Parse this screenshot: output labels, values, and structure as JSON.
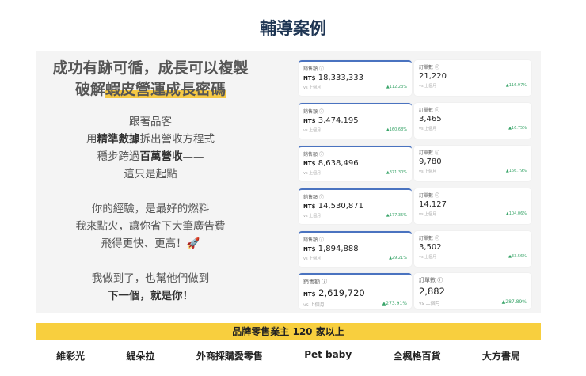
{
  "title": "輔導案例",
  "headline": {
    "line1": "成功有跡可循，成長可以複製",
    "line2_plain": "破解",
    "line2_highlight": "蝦皮營運成長密碼"
  },
  "para1": [
    [
      {
        "t": "跟著品客"
      }
    ],
    [
      {
        "t": "用"
      },
      {
        "t": "精準數據",
        "b": true
      },
      {
        "t": "拆出營收方程式"
      }
    ],
    [
      {
        "t": "穩步跨過"
      },
      {
        "t": "百萬營收",
        "b": true
      },
      {
        "t": "——"
      }
    ],
    [
      {
        "t": "這只是起點"
      }
    ]
  ],
  "para2": [
    "你的經驗，是最好的燃料",
    "我來點火，讓你省下大筆廣告費",
    "飛得更快、更高！🚀"
  ],
  "para3": {
    "line1": "我做到了，也幫他們做到",
    "line2": "下一個，就是你！"
  },
  "card_labels": {
    "sales": "銷售額",
    "orders": "訂單數",
    "currency": "NT$",
    "compare": "vs 上個月",
    "info_icon": "ⓘ",
    "up_icon": "▲"
  },
  "cases": [
    {
      "sales": "18,333,333",
      "sales_pct": "112.23%",
      "orders": "21,220",
      "orders_pct": "116.97%"
    },
    {
      "sales": "3,474,195",
      "sales_pct": "160.68%",
      "orders": "3,465",
      "orders_pct": "16.75%"
    },
    {
      "sales": "8,638,496",
      "sales_pct": "371.30%",
      "orders": "9,780",
      "orders_pct": "166.79%"
    },
    {
      "sales": "14,530,871",
      "sales_pct": "177.35%",
      "orders": "14,127",
      "orders_pct": "104.06%"
    },
    {
      "sales": "1,894,888",
      "sales_pct": "29.21%",
      "orders": "3,502",
      "orders_pct": "33.56%"
    },
    {
      "sales": "2,619,720",
      "sales_pct": "273.91%",
      "orders": "2,882",
      "orders_pct": "287.89%"
    }
  ],
  "banner": "品牌零售業主 120 家以上",
  "brands": [
    "維彩光",
    "緹朵拉",
    "外商採購愛零售",
    "Pet baby",
    "全楓格百貨",
    "大方書局"
  ]
}
